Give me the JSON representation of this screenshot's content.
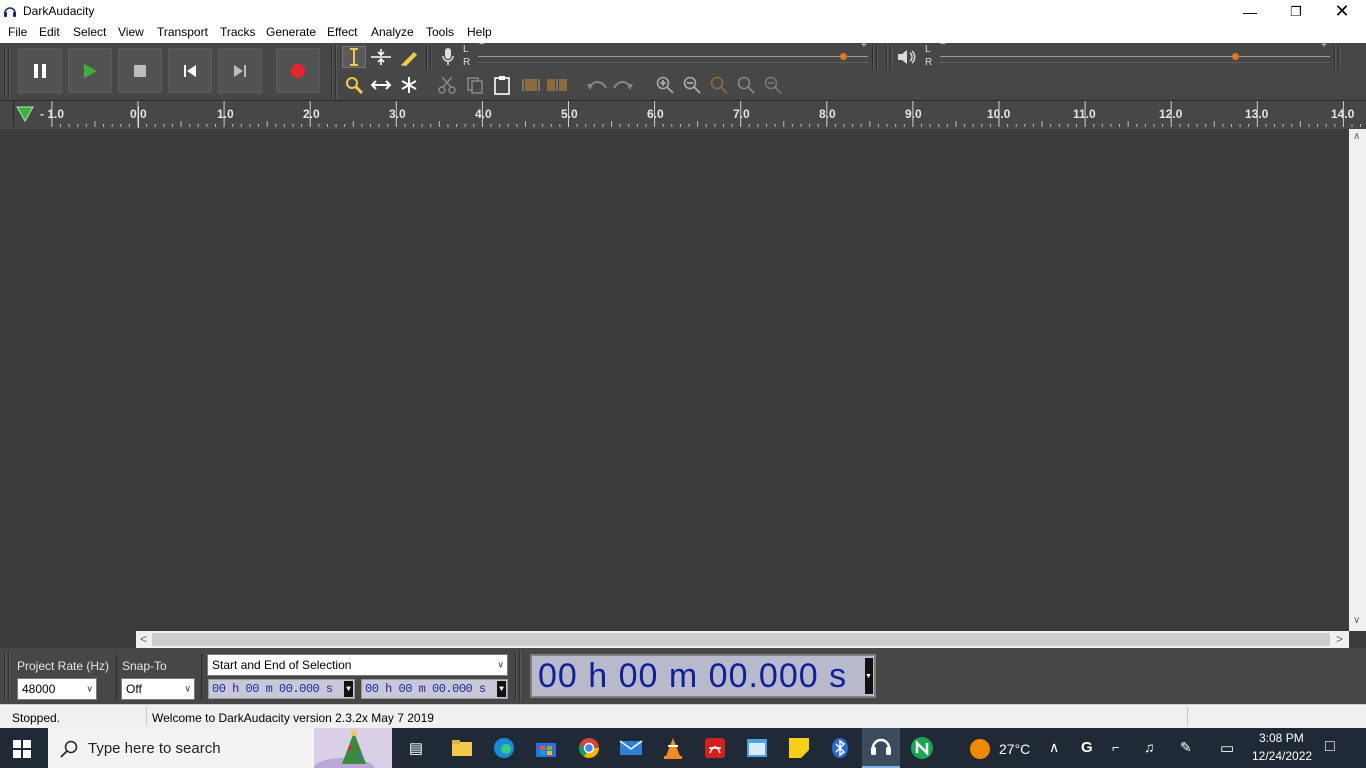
{
  "window": {
    "title": "DarkAudacity",
    "minimize_icon": "minimize-icon",
    "maximize_icon": "restore-icon",
    "close_icon": "close-icon"
  },
  "menu": [
    "File",
    "Edit",
    "Select",
    "View",
    "Transport",
    "Tracks",
    "Generate",
    "Effect",
    "Analyze",
    "Tools",
    "Help"
  ],
  "transport": {
    "pause": "pause-icon",
    "play": "play-icon",
    "stop": "stop-icon",
    "skip_start": "skip-to-start-icon",
    "skip_end": "skip-to-end-icon",
    "record": "record-icon"
  },
  "meters": {
    "record_L": "L",
    "record_R": "R",
    "play_L": "L",
    "play_R": "R",
    "minus": "−",
    "plus": "+"
  },
  "ruler": {
    "labels": [
      "- 1.0",
      "0.0",
      "1.0",
      "2.0",
      "3.0",
      "4.0",
      "5.0",
      "6.0",
      "7.0",
      "8.0",
      "9.0",
      "10.0",
      "11.0",
      "12.0",
      "13.0",
      "14.0"
    ]
  },
  "selection_toolbar": {
    "project_rate_label": "Project Rate (Hz)",
    "project_rate_value": "48000",
    "snap_to_label": "Snap-To",
    "snap_to_value": "Off",
    "selection_mode": "Start and End of Selection",
    "start_time": "00 h 00 m 00.000 s",
    "end_time": "00 h 00 m 00.000 s",
    "audio_position": "00 h 00 m 00.000 s"
  },
  "status": {
    "state": "Stopped.",
    "message": "Welcome to DarkAudacity version 2.3.2x  May  7 2019"
  },
  "taskbar": {
    "search_placeholder": "Type here to search",
    "weather": "27°C",
    "time": "3:08 PM",
    "date": "12/24/2022"
  },
  "colors": {
    "accent_orange": "#e07a1f",
    "record_red": "#e8232a",
    "play_green": "#3bb33b",
    "time_text": "#11209a"
  }
}
